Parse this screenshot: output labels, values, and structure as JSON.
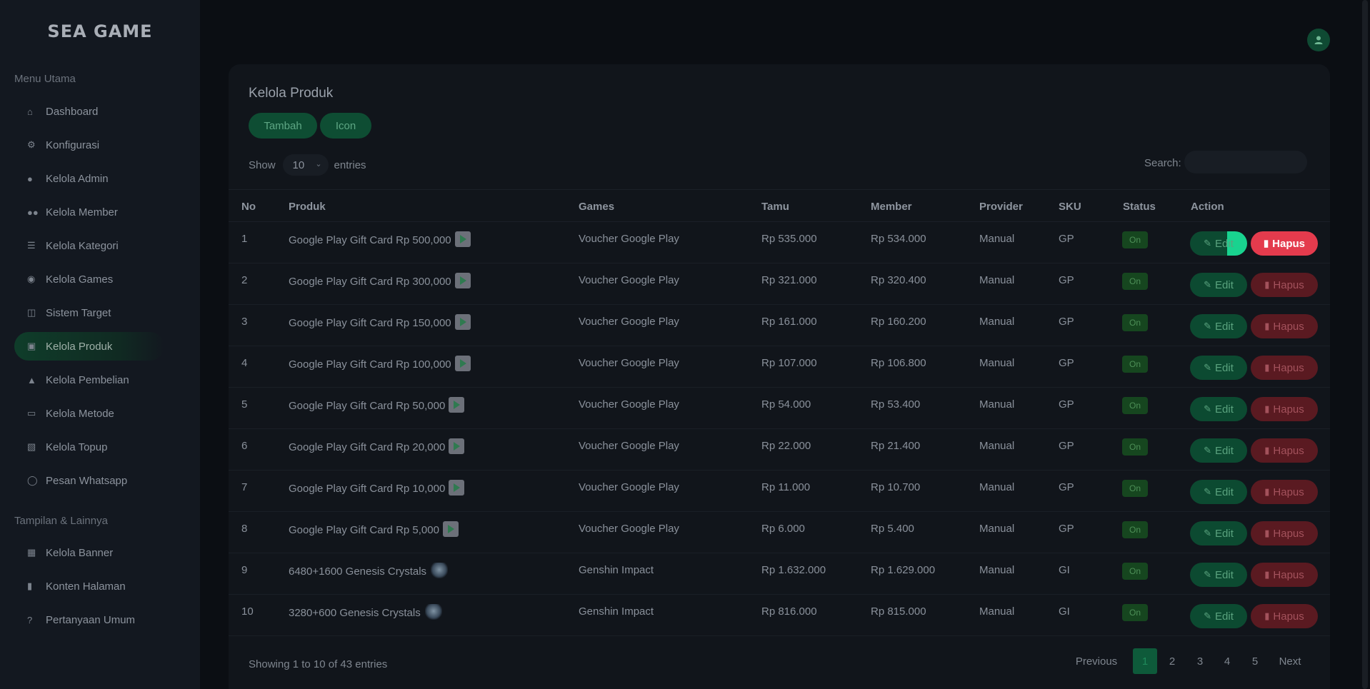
{
  "app": {
    "logo": "SEA GAME"
  },
  "sidebar": {
    "section_main": "Menu Utama",
    "section_other": "Tampilan & Lainnya",
    "items": [
      {
        "label": "Dashboard",
        "icon": "home-icon"
      },
      {
        "label": "Konfigurasi",
        "icon": "gear-icon"
      },
      {
        "label": "Kelola Admin",
        "icon": "user-icon"
      },
      {
        "label": "Kelola Member",
        "icon": "users-icon"
      },
      {
        "label": "Kelola Kategori",
        "icon": "list-icon"
      },
      {
        "label": "Kelola Games",
        "icon": "gamepad-icon"
      },
      {
        "label": "Sistem Target",
        "icon": "database-icon"
      },
      {
        "label": "Kelola Produk",
        "icon": "calendar-icon",
        "active": true
      },
      {
        "label": "Kelola Pembelian",
        "icon": "basket-icon"
      },
      {
        "label": "Kelola Metode",
        "icon": "credit-card-icon"
      },
      {
        "label": "Kelola Topup",
        "icon": "wallet-icon"
      },
      {
        "label": "Pesan Whatsapp",
        "icon": "whatsapp-icon"
      }
    ],
    "items_other": [
      {
        "label": "Kelola Banner",
        "icon": "image-icon"
      },
      {
        "label": "Konten Halaman",
        "icon": "file-icon"
      },
      {
        "label": "Pertanyaan Umum",
        "icon": "question-icon"
      }
    ]
  },
  "page": {
    "title": "Kelola Produk",
    "add_label": "Tambah",
    "icon_label": "Icon",
    "show_label": "Show",
    "entries_value": "10",
    "entries_label": "entries",
    "search_label": "Search:",
    "search_value": ""
  },
  "table": {
    "headers": [
      "No",
      "Produk",
      "Games",
      "Tamu",
      "Member",
      "Provider",
      "SKU",
      "Status",
      "Action"
    ],
    "rows": [
      {
        "no": "1",
        "produk": "Google Play Gift Card Rp 500,000",
        "icon": "google-play-icon",
        "games": "Voucher Google Play",
        "tamu": "Rp 535.000",
        "member": "Rp 534.000",
        "provider": "Manual",
        "sku": "GP",
        "status": "On"
      },
      {
        "no": "2",
        "produk": "Google Play Gift Card Rp 300,000",
        "icon": "google-play-icon",
        "games": "Voucher Google Play",
        "tamu": "Rp 321.000",
        "member": "Rp 320.400",
        "provider": "Manual",
        "sku": "GP",
        "status": "On"
      },
      {
        "no": "3",
        "produk": "Google Play Gift Card Rp 150,000",
        "icon": "google-play-icon",
        "games": "Voucher Google Play",
        "tamu": "Rp 161.000",
        "member": "Rp 160.200",
        "provider": "Manual",
        "sku": "GP",
        "status": "On"
      },
      {
        "no": "4",
        "produk": "Google Play Gift Card Rp 100,000",
        "icon": "google-play-icon",
        "games": "Voucher Google Play",
        "tamu": "Rp 107.000",
        "member": "Rp 106.800",
        "provider": "Manual",
        "sku": "GP",
        "status": "On"
      },
      {
        "no": "5",
        "produk": "Google Play Gift Card Rp 50,000",
        "icon": "google-play-icon",
        "games": "Voucher Google Play",
        "tamu": "Rp 54.000",
        "member": "Rp 53.400",
        "provider": "Manual",
        "sku": "GP",
        "status": "On"
      },
      {
        "no": "6",
        "produk": "Google Play Gift Card Rp 20,000",
        "icon": "google-play-icon",
        "games": "Voucher Google Play",
        "tamu": "Rp 22.000",
        "member": "Rp 21.400",
        "provider": "Manual",
        "sku": "GP",
        "status": "On"
      },
      {
        "no": "7",
        "produk": "Google Play Gift Card Rp 10,000",
        "icon": "google-play-icon",
        "games": "Voucher Google Play",
        "tamu": "Rp 11.000",
        "member": "Rp 10.700",
        "provider": "Manual",
        "sku": "GP",
        "status": "On"
      },
      {
        "no": "8",
        "produk": "Google Play Gift Card Rp 5,000",
        "icon": "google-play-icon",
        "games": "Voucher Google Play",
        "tamu": "Rp 6.000",
        "member": "Rp 5.400",
        "provider": "Manual",
        "sku": "GP",
        "status": "On"
      },
      {
        "no": "9",
        "produk": "6480+1600 Genesis Crystals",
        "icon": "genesis-crystal-icon",
        "games": "Genshin Impact",
        "tamu": "Rp 1.632.000",
        "member": "Rp 1.629.000",
        "provider": "Manual",
        "sku": "GI",
        "status": "On"
      },
      {
        "no": "10",
        "produk": "3280+600 Genesis Crystals",
        "icon": "genesis-crystal-icon",
        "games": "Genshin Impact",
        "tamu": "Rp 816.000",
        "member": "Rp 815.000",
        "provider": "Manual",
        "sku": "GI",
        "status": "On"
      }
    ],
    "edit_label": "Edit",
    "delete_label": "Hapus"
  },
  "footer": {
    "info": "Showing 1 to 10 of 43 entries",
    "previous": "Previous",
    "pages": [
      "1",
      "2",
      "3",
      "4",
      "5"
    ],
    "next": "Next",
    "current_page": "1"
  },
  "colors": {
    "accent_green": "#0e4d33",
    "danger_red": "#e43b4d",
    "background": "#0b0e13",
    "sidebar": "#131820"
  }
}
